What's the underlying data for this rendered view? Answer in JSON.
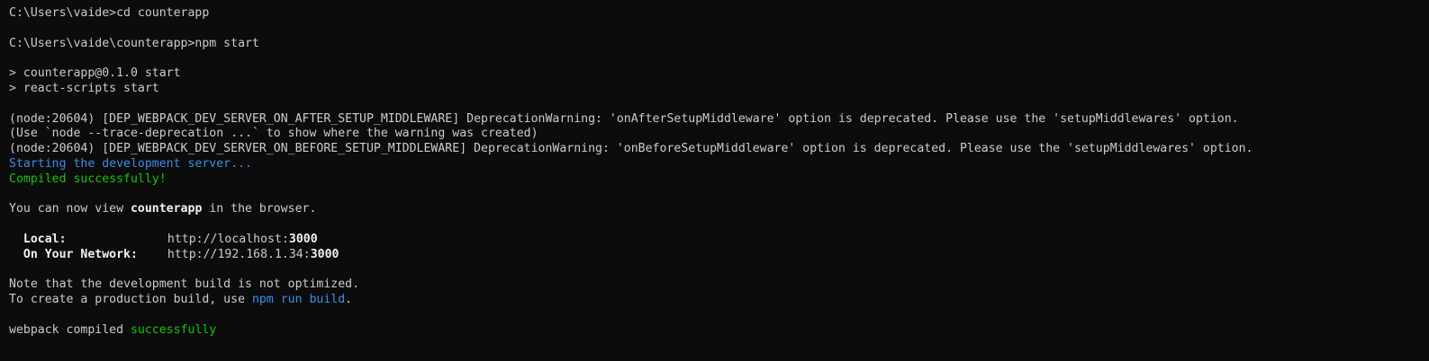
{
  "terminal": {
    "prompt1": "C:\\Users\\vaide>cd counterapp",
    "prompt2": "C:\\Users\\vaide\\counterapp>npm start",
    "script1": "> counterapp@0.1.0 start",
    "script2": "> react-scripts start",
    "warn1": "(node:20604) [DEP_WEBPACK_DEV_SERVER_ON_AFTER_SETUP_MIDDLEWARE] DeprecationWarning: 'onAfterSetupMiddleware' option is deprecated. Please use the 'setupMiddlewares' option.",
    "warn2": "(Use `node --trace-deprecation ...` to show where the warning was created)",
    "warn3": "(node:20604) [DEP_WEBPACK_DEV_SERVER_ON_BEFORE_SETUP_MIDDLEWARE] DeprecationWarning: 'onBeforeSetupMiddleware' option is deprecated. Please use the 'setupMiddlewares' option.",
    "starting": "Starting the development server...",
    "compiled": "Compiled successfully!",
    "view_prefix": "You can now view ",
    "view_app": "counterapp",
    "view_suffix": " in the browser.",
    "local_label": "Local:",
    "local_url_prefix": "http://localhost:",
    "local_port": "3000",
    "network_label": "On Your Network:",
    "network_url_prefix": "http://192.168.1.34:",
    "network_port": "3000",
    "note1": "Note that the development build is not optimized.",
    "note2_prefix": "To create a production build, use ",
    "note2_cmd": "npm run build",
    "note2_suffix": ".",
    "webpack_prefix": "webpack compiled ",
    "webpack_status": "successfully"
  },
  "colors": {
    "background": "#0c0c0c",
    "text": "#cccccc",
    "blue": "#3b8eea",
    "green": "#16c60c"
  }
}
